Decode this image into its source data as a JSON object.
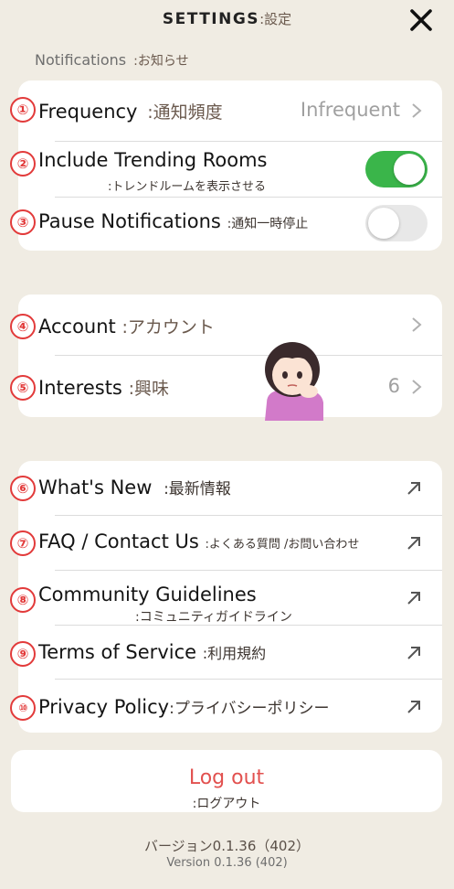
{
  "header": {
    "title": "SETTINGS",
    "title_jp": ":設定",
    "close_icon": "close-icon"
  },
  "notifications": {
    "section_label": "Notifications",
    "section_label_jp": ":お知らせ",
    "frequency": {
      "number": "①",
      "label": "Frequency",
      "label_jp": ":通知頻度",
      "value": "Infrequent"
    },
    "trending": {
      "number": "②",
      "label": "Include Trending Rooms",
      "label_jp": ":トレンドルームを表示させる",
      "toggle_on": true
    },
    "pause": {
      "number": "③",
      "label": "Pause Notifications",
      "label_jp": ":通知一時停止",
      "toggle_on": false
    }
  },
  "account": {
    "account_row": {
      "number": "④",
      "label": "Account",
      "label_jp": ":アカウント"
    },
    "interests_row": {
      "number": "⑤",
      "label": "Interests",
      "label_jp": ":興味",
      "count": "6"
    }
  },
  "links": [
    {
      "number": "⑥",
      "label": "What's New",
      "label_jp": ":最新情報"
    },
    {
      "number": "⑦",
      "label": "FAQ / Contact Us",
      "label_jp": ":よくある質問 /お問い合わせ"
    },
    {
      "number": "⑧",
      "label": "Community Guidelines",
      "label_jp": ":コミュニティガイドライン"
    },
    {
      "number": "⑨",
      "label": "Terms of Service",
      "label_jp": ":利用規約"
    },
    {
      "number": "⑩",
      "label": "Privacy Policy",
      "label_jp": ":プライバシーポリシー"
    }
  ],
  "logout": {
    "label": "Log out",
    "label_jp": ":ログアウト"
  },
  "version": {
    "jp": "バージョン0.1.36（402）",
    "en": "Version 0.1.36 (402)"
  },
  "colors": {
    "background": "#f0ece3",
    "toggle_on": "#3ab54a",
    "logout": "#e2514f",
    "annotation_number": "#e23a3a"
  }
}
